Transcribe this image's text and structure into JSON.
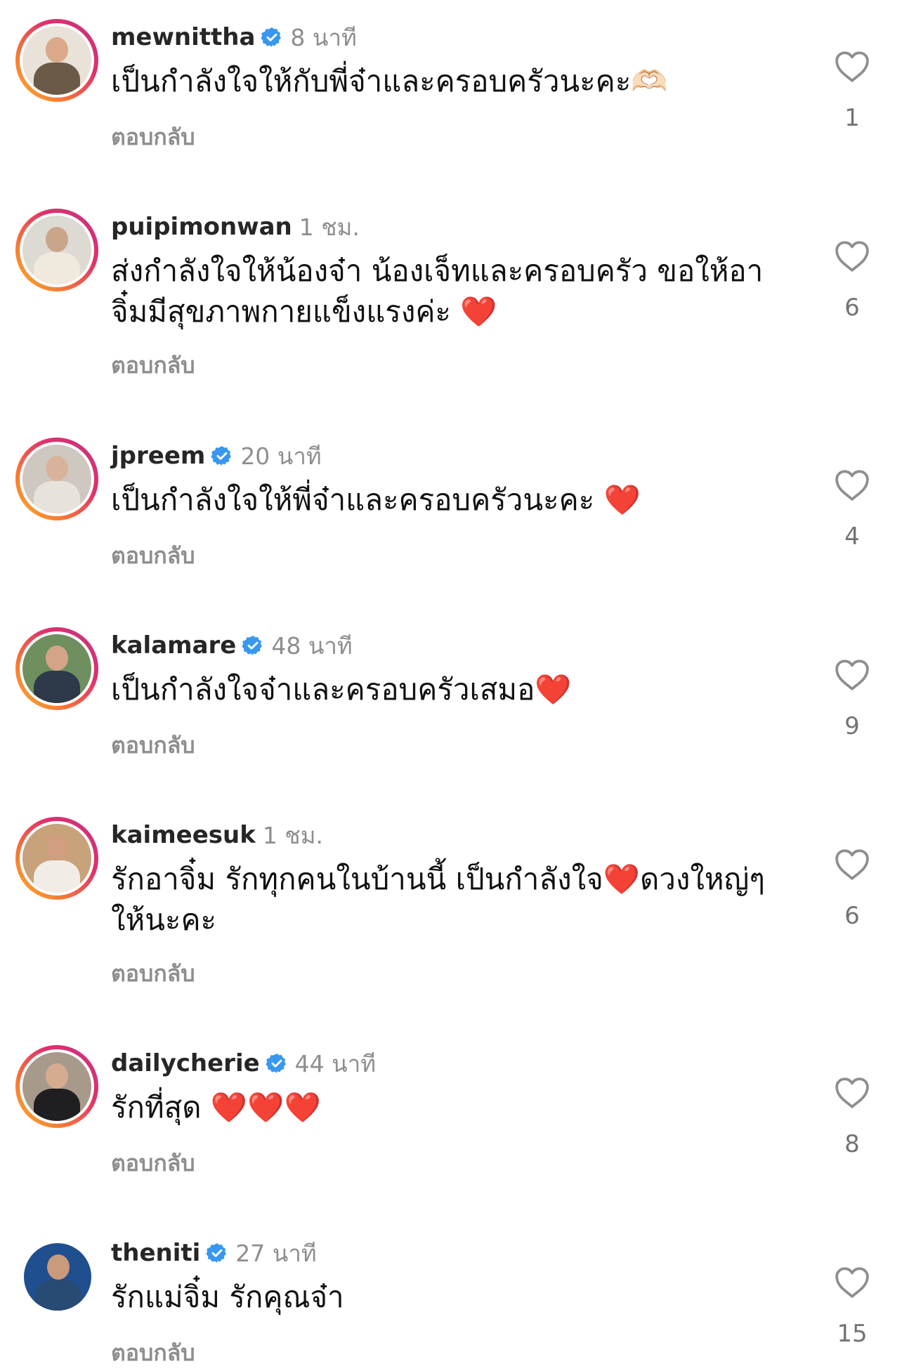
{
  "comments": [
    {
      "username": "mewnittha",
      "verified": true,
      "time": "8 นาที",
      "text": "เป็นกำลังใจให้กับพี่จ๋าและครอบครัวนะคะ🫶🏻",
      "reply": "ตอบกลับ",
      "likes": "1"
    },
    {
      "username": "puipimonwan",
      "verified": false,
      "time": "1 ชม.",
      "text": "ส่งกำลังใจให้น้องจ๋า น้องเจ็ทและครอบครัว ขอให้อาจิ๋มมีสุขภาพกายแข็งแรงค่ะ ❤️",
      "reply": "ตอบกลับ",
      "likes": "6"
    },
    {
      "username": "jpreem",
      "verified": true,
      "time": "20 นาที",
      "text": "เป็นกำลังใจให้พี่จ๋าและครอบครัวนะคะ ❤️",
      "reply": "ตอบกลับ",
      "likes": "4"
    },
    {
      "username": "kalamare",
      "verified": true,
      "time": "48 นาที",
      "text": "เป็นกำลังใจจ๋าและครอบครัวเสมอ❤️",
      "reply": "ตอบกลับ",
      "likes": "9"
    },
    {
      "username": "kaimeesuk",
      "verified": false,
      "time": "1 ชม.",
      "text": "รักอาจิ๋ม รักทุกคนในบ้านนี้ เป็นกำลังใจ❤️ดวงใหญ่ๆให้นะคะ",
      "reply": "ตอบกลับ",
      "likes": "6"
    },
    {
      "username": "dailycherie",
      "verified": true,
      "time": "44 นาที",
      "text": "รักที่สุด ❤️❤️❤️",
      "reply": "ตอบกลับ",
      "likes": "8"
    },
    {
      "username": "theniti",
      "verified": true,
      "time": "27 นาที",
      "text": "รักแม่จิ๋ม รักคุณจ๋า",
      "reply": "ตอบกลับ",
      "likes": "15"
    }
  ],
  "colors": {
    "verified_badge": "#3897f0",
    "secondary_text": "#8e8e8e",
    "primary_text": "#111111"
  },
  "icons": {
    "like": "heart-outline-icon",
    "verified": "verified-badge-icon"
  }
}
